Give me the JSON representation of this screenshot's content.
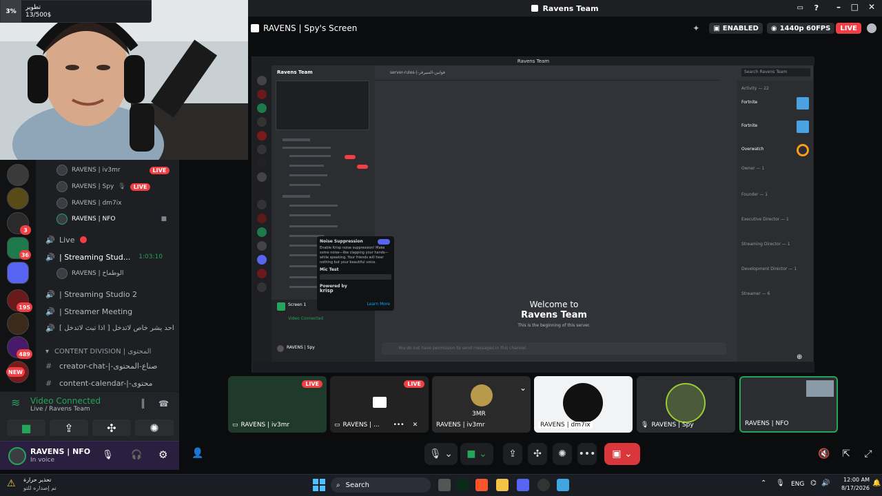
{
  "goal": {
    "percent": "3%",
    "label": "تطوير",
    "amount": "13/500$"
  },
  "app_title": "Ravens Team",
  "stream_title": "RAVENS | Spy's Screen",
  "stream_badges": {
    "enabled": "ENABLED",
    "quality": "1440p 60FPS",
    "live": "LIVE"
  },
  "servers": [
    {
      "badge": ""
    },
    {
      "badge": ""
    },
    {
      "badge": "3"
    },
    {
      "badge": "36"
    },
    {
      "badge": ""
    },
    {
      "badge": "195"
    },
    {
      "badge": ""
    },
    {
      "badge": "489"
    },
    {
      "badge": "NEW"
    }
  ],
  "channels": {
    "voice_users": [
      {
        "name": "RAVENS | iv3mr",
        "live": "LIVE"
      },
      {
        "name": "RAVENS | Spy",
        "live": "LIVE"
      },
      {
        "name": "RAVENS | dm7ix",
        "live": ""
      },
      {
        "name": "RAVENS | NFO",
        "live": ""
      }
    ],
    "live_header": "Live",
    "studio1": "| Streaming Stud...",
    "studio1_time": "1:03:10",
    "studio1_user": "RAVENS | الوطماخ",
    "studio2": "| Streaming Studio 2",
    "meeting": "| Streamer Meeting",
    "notice": "احد يشر خاص لاتدخل [ اذا تبث لاتدخل ]",
    "category": "CONTENT DIVISION | المحتوى",
    "creator_chat": "creator-chat-|-صناع-المحتوى",
    "content_calendar": "content-calendar-|-محتوى"
  },
  "voice_panel": {
    "status": "Video Connected",
    "sub": "Live / Ravens Team"
  },
  "user_panel": {
    "name": "RAVENS | NFO",
    "status": "In voice"
  },
  "shared_screen": {
    "server_name": "Ravens Team",
    "channel": "server-rules-|-قوانين-السيرفر",
    "search": "Search Ravens Team",
    "welcome": "Welcome to",
    "welcome_server": "Ravens Team",
    "welcome_sub": "This is the beginning of this server.",
    "input_placeholder": "You do not have permission to send messages in this channel.",
    "activity": "Activity — 22",
    "noise_title": "Noise Suppression",
    "noise_desc": "Enable Krisp noise suppression! Make some noise—like clapping your hands—while speaking. Your friends will hear nothing but your beautiful voice.",
    "mic_test": "Mic Test",
    "powered_by": "Powered by",
    "krisp": "krisp",
    "learn_more": "Learn More",
    "screen_label": "Screen 1",
    "video_connected": "Video Connected",
    "bottom_user": "RAVENS | Spy",
    "games": [
      {
        "title": "Fortnite"
      },
      {
        "title": "Fortnite"
      },
      {
        "title": "Overwatch"
      }
    ],
    "roles": [
      "Owner — 1",
      "Founder — 1",
      "Executive Director — 1",
      "Streaming Director — 1",
      "Development Director — 1",
      "Streamer — 6"
    ]
  },
  "tiles": [
    {
      "name": "RAVENS | iv3mr",
      "live": "LIVE"
    },
    {
      "name": "RAVENS | ...",
      "live": "LIVE"
    },
    {
      "name": "RAVENS | iv3mr",
      "live": ""
    },
    {
      "name": "RAVENS | dm7ix",
      "live": ""
    },
    {
      "name": "RAVENS | Spy",
      "live": ""
    },
    {
      "name": "RAVENS | NFO",
      "live": ""
    }
  ],
  "tile3_caption": "3MR",
  "taskbar": {
    "alert_title": "تحذير حرارة",
    "alert_sub": "تم إصداره للتو",
    "search": "Search",
    "lang": "ENG",
    "time": "12:00 AM",
    "date": "8/17/2026"
  },
  "colors": {
    "accent": "#5865f2",
    "live": "#f23f43",
    "green": "#23a55a",
    "purple_user": "#2b1f3f"
  }
}
